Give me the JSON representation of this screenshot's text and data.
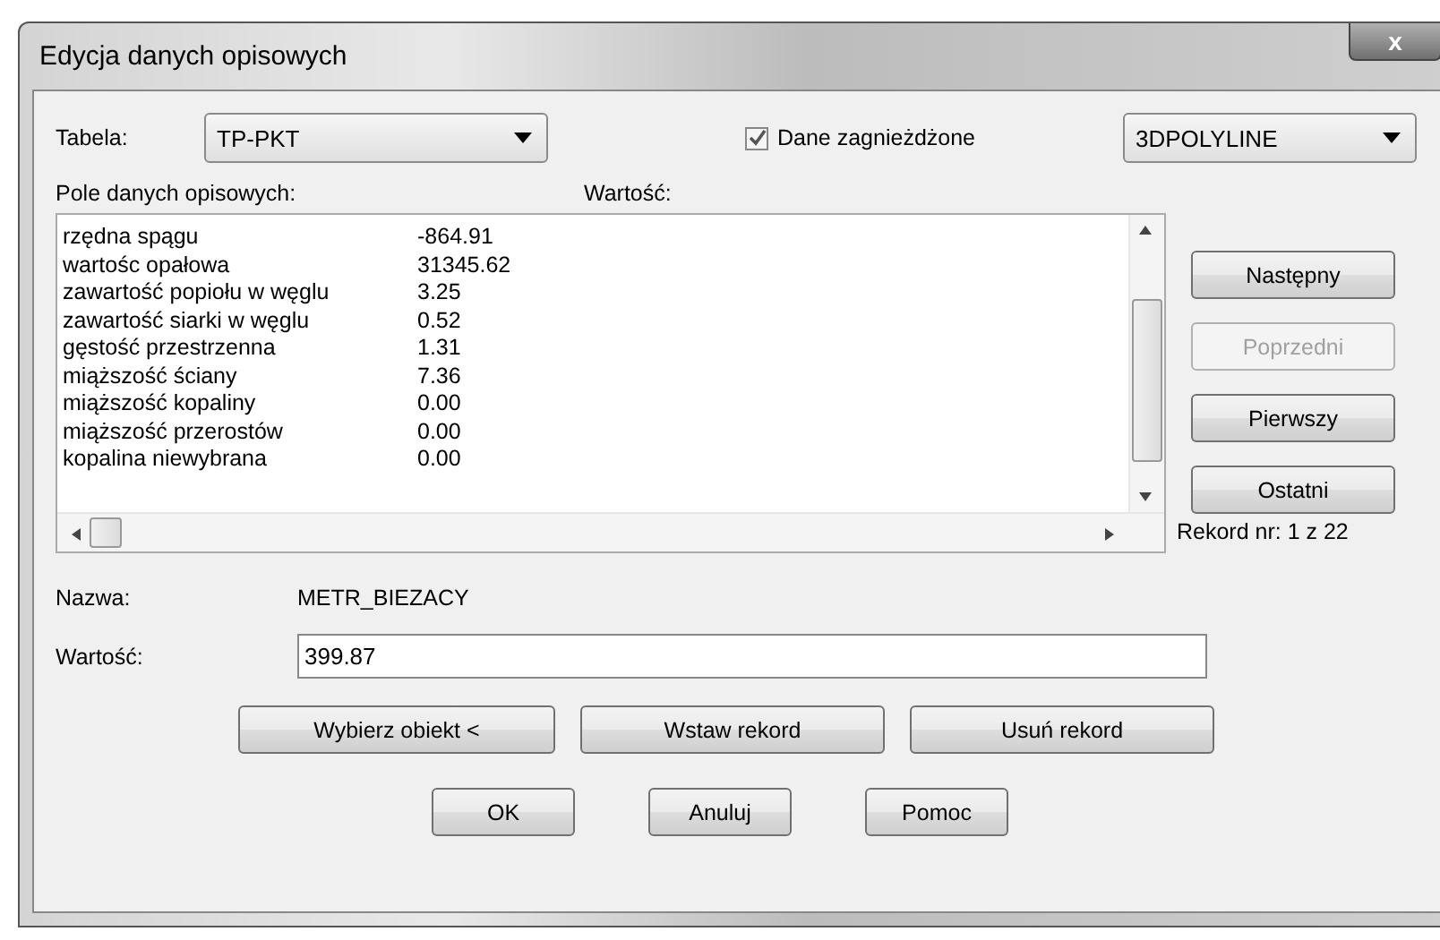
{
  "window": {
    "title": "Edycja danych opisowych",
    "close": "x"
  },
  "table_label": "Tabela:",
  "table_combo": {
    "value": "TP-PKT"
  },
  "nested_checkbox": {
    "label": "Dane zagnieżdżone",
    "checked": true
  },
  "type_combo": {
    "value": "3DPOLYLINE"
  },
  "columns": [
    "Pole danych opisowych:",
    "Wartość:"
  ],
  "rows": [
    {
      "field": "rzędna spągu",
      "value": "-864.91"
    },
    {
      "field": "wartośc opałowa",
      "value": "31345.62"
    },
    {
      "field": "zawartość popiołu w węglu",
      "value": "3.25"
    },
    {
      "field": "zawartość siarki w węglu",
      "value": "0.52"
    },
    {
      "field": "gęstość przestrzenna",
      "value": "1.31"
    },
    {
      "field": "miąższość ściany",
      "value": "7.36"
    },
    {
      "field": "miąższość kopaliny",
      "value": "0.00"
    },
    {
      "field": "miąższość przerostów",
      "value": "0.00"
    },
    {
      "field": "kopalina niewybrana",
      "value": "0.00"
    }
  ],
  "nav_buttons": [
    {
      "label": "Następny",
      "disabled": false
    },
    {
      "label": "Poprzedni",
      "disabled": true
    },
    {
      "label": "Pierwszy",
      "disabled": false
    },
    {
      "label": "Ostatni",
      "disabled": false
    }
  ],
  "record_counter": "Rekord nr: 1 z 22",
  "name_label": "Nazwa:",
  "name_value": "METR_BIEZACY",
  "value_label": "Wartość:",
  "value_field": {
    "value": "399.87"
  },
  "record_buttons": [
    "Wybierz obiekt <",
    "Wstaw rekord",
    "Usuń rekord"
  ],
  "dialog_buttons": [
    "OK",
    "Anuluj",
    "Pomoc"
  ]
}
